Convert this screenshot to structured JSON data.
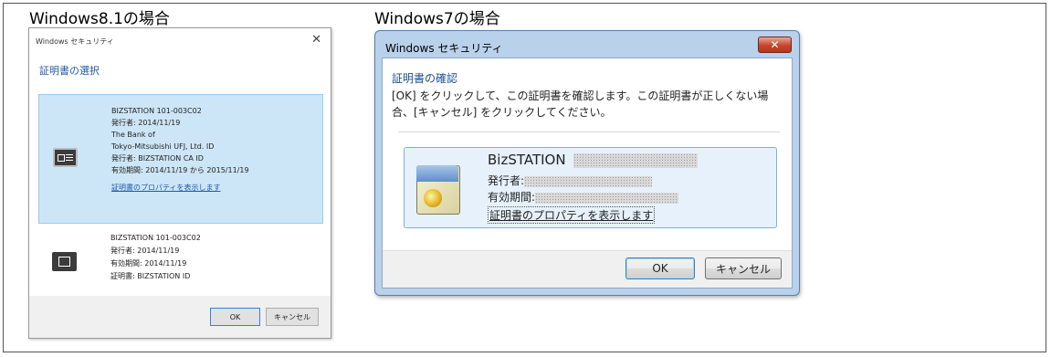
{
  "labels": {
    "win81": "Windows8.1の場合",
    "win7": "Windows7の場合"
  },
  "win81_dialog": {
    "title": "Windows セキュリティ",
    "close_glyph": "✕",
    "heading": "証明書の選択",
    "certificates": [
      {
        "selected": true,
        "icon": "certificate-card-icon",
        "lines": [
          "BIZSTATION 101-003C02",
          "発行者: 2014/11/19",
          "The Bank of",
          "Tokyo-Mitsubishi UFJ, Ltd. ID",
          "発行者: BIZSTATION CA ID",
          "有効期間: 2014/11/19 から 2015/11/19"
        ],
        "link": "証明書のプロパティを表示します"
      },
      {
        "selected": false,
        "icon": "smartcard-icon",
        "lines": [
          "BIZSTATION 101-003C02",
          "発行者: 2014/11/19",
          "有効期間: 2014/11/19",
          "証明書: BIZSTATION ID"
        ]
      }
    ],
    "buttons": {
      "ok": "OK",
      "cancel": "キャンセル"
    }
  },
  "win7_dialog": {
    "title": "Windows セキュリティ",
    "close_glyph": "✕",
    "heading": "証明書の確認",
    "description": "[OK] をクリックして、この証明書を確認します。この証明書が正しくない場合、[キャンセル] をクリックしてください。",
    "certificate": {
      "icon": "certificate-icon",
      "name": "BizSTATION",
      "issuer_label": "発行者:",
      "validity_label": "有効期間:",
      "link": "証明書のプロパティを表示します"
    },
    "buttons": {
      "ok": "OK",
      "cancel": "キャンセル"
    }
  }
}
